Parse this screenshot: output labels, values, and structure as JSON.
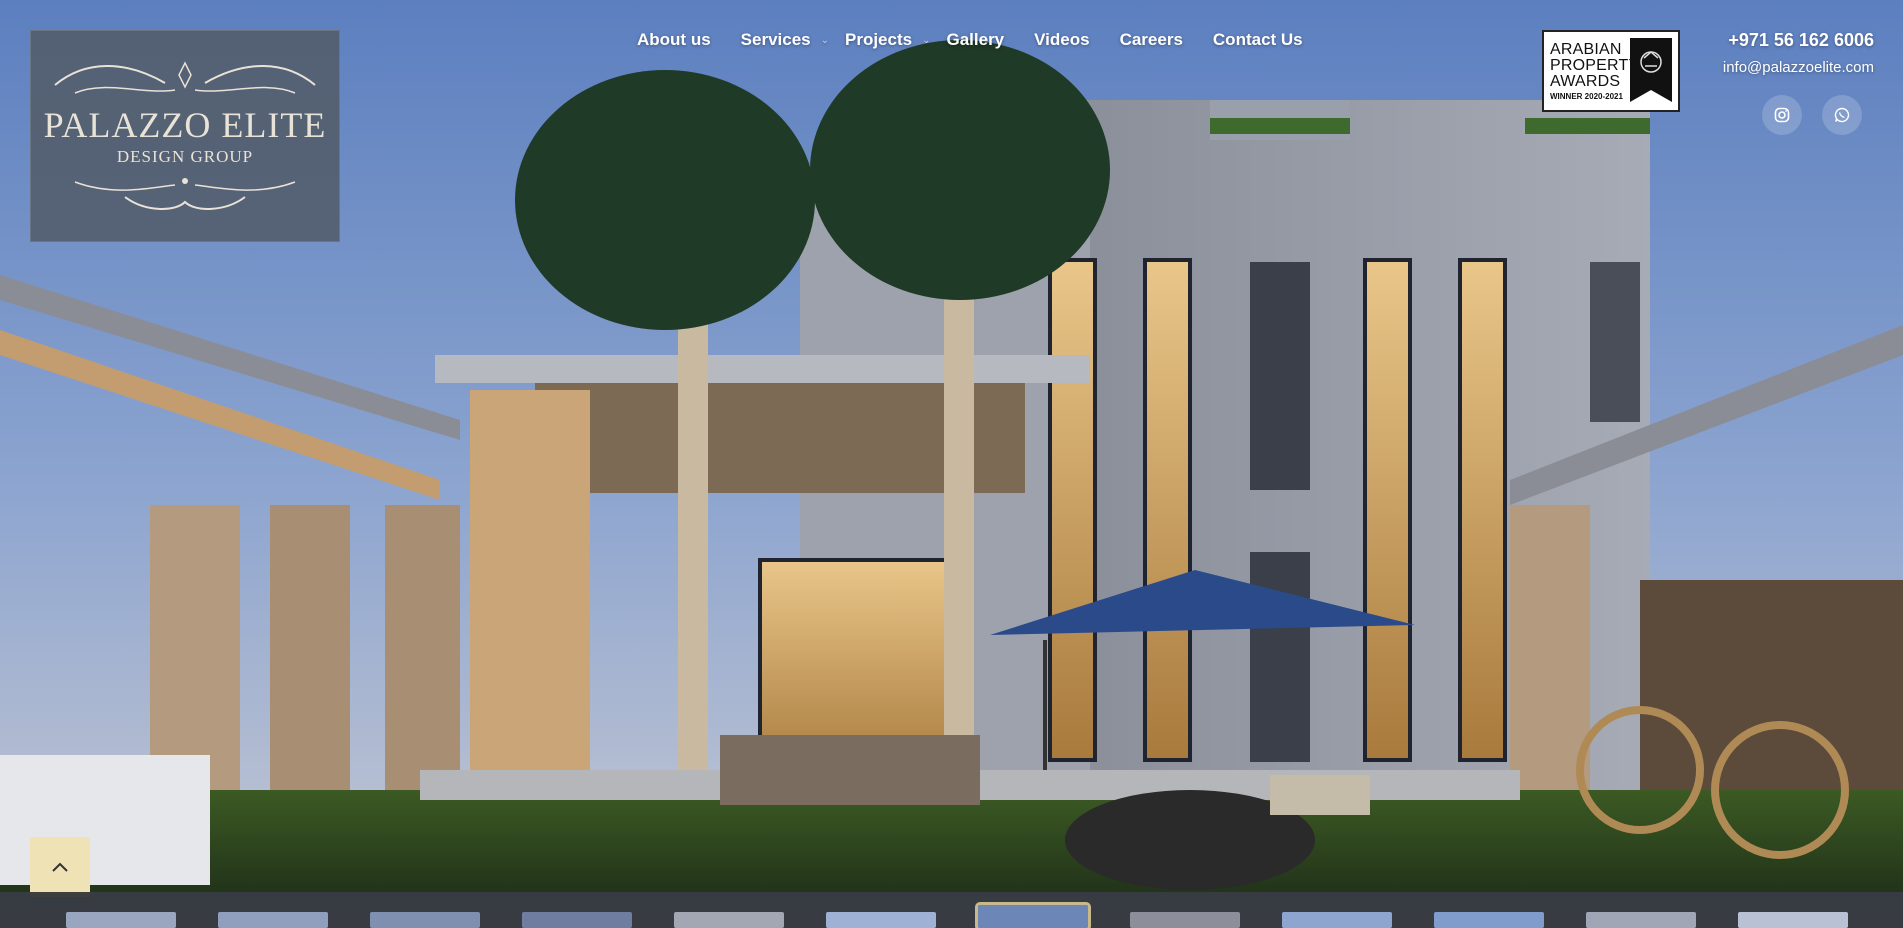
{
  "brand": {
    "name": "PALAZZO ELITE",
    "tagline": "DESIGN GROUP"
  },
  "nav": {
    "items": [
      {
        "label": "About us",
        "has_submenu": false
      },
      {
        "label": "Services",
        "has_submenu": true
      },
      {
        "label": "Projects",
        "has_submenu": true
      },
      {
        "label": "Gallery",
        "has_submenu": false
      },
      {
        "label": "Videos",
        "has_submenu": false
      },
      {
        "label": "Careers",
        "has_submenu": false
      },
      {
        "label": "Contact Us",
        "has_submenu": false
      }
    ]
  },
  "award": {
    "line1": "ARABIAN",
    "line2": "PROPERTY",
    "line3": "AWARDS",
    "winner": "WINNER 2020-2021"
  },
  "contact": {
    "phone": "+971 56 162 6006",
    "email": "info@palazzoelite.com"
  },
  "social": {
    "icons": [
      "instagram-icon",
      "whatsapp-icon"
    ]
  },
  "thumbnails": {
    "count": 12,
    "active_index": 6
  },
  "colors": {
    "logo_bg": "#545e6e",
    "logo_text": "#e8e3d6",
    "to_top_bg": "#efe2b5",
    "active_thumb_border": "#c9b98a",
    "nav_text": "#ffffff"
  }
}
